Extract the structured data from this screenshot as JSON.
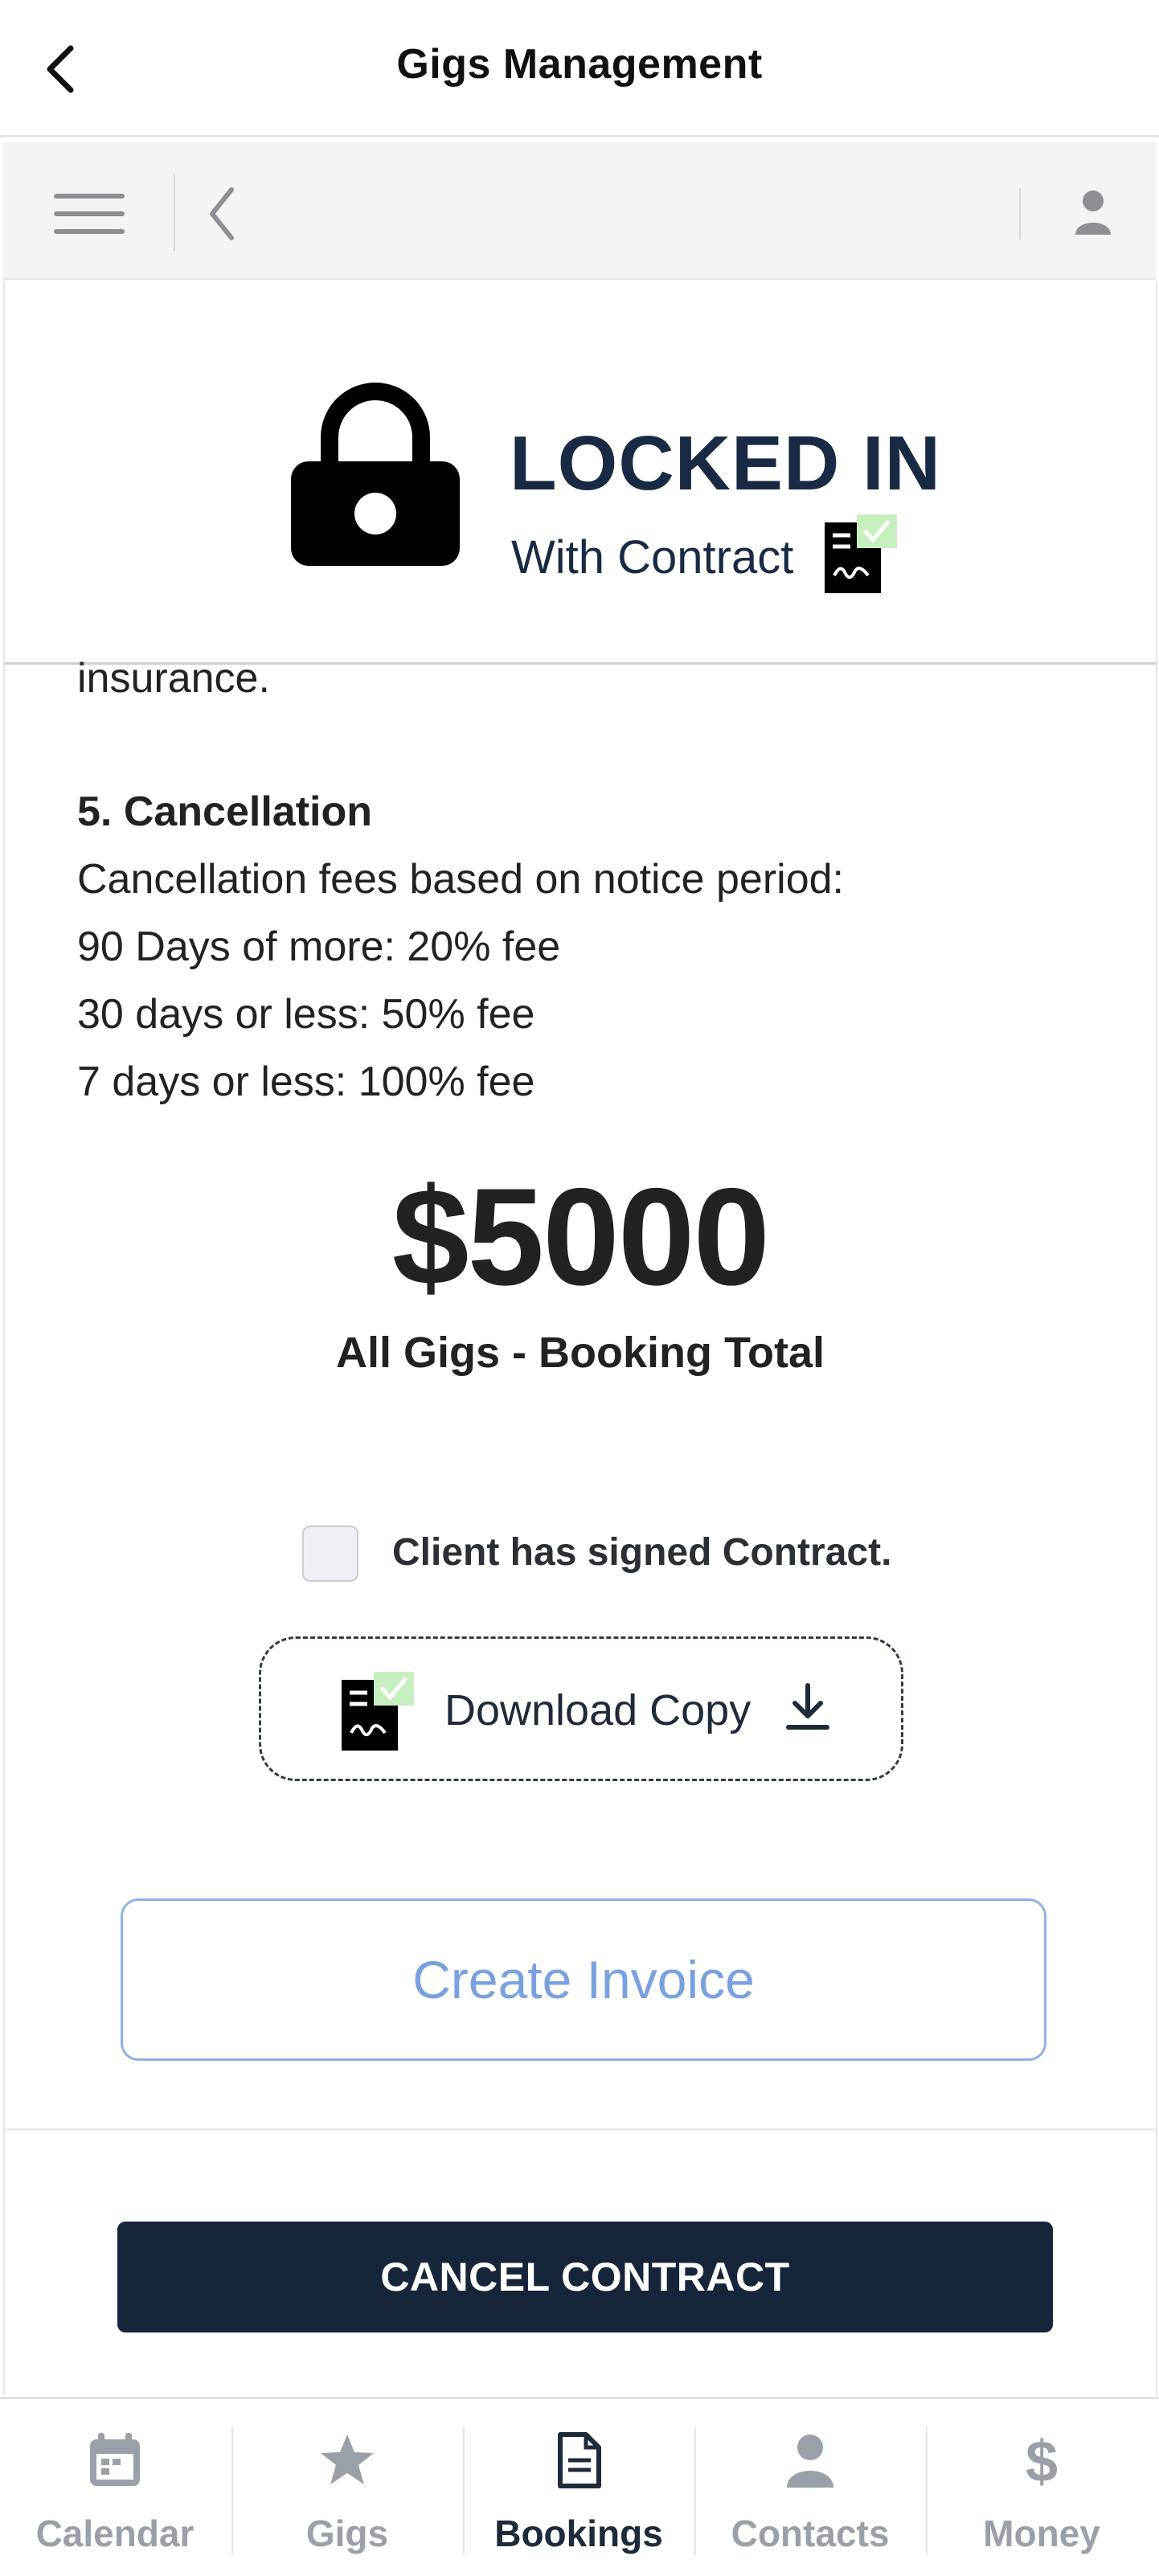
{
  "header": {
    "title": "Gigs Management"
  },
  "lock": {
    "title": "LOCKED IN",
    "subtitle": "With Contract"
  },
  "contract_text": {
    "line_partial": "insurance.",
    "section_heading": "5. Cancellation",
    "lines": [
      "Cancellation fees based on notice period:",
      "90 Days of more: 20% fee",
      "30 days or less: 50% fee",
      "7 days or less: 100% fee"
    ]
  },
  "booking": {
    "total": "$5000",
    "total_label": "All Gigs - Booking Total"
  },
  "signed_checkbox": {
    "label": "Client has signed Contract.",
    "checked": false
  },
  "download": {
    "label": "Download Copy"
  },
  "invoice": {
    "label": "Create Invoice"
  },
  "cancel": {
    "label": "CANCEL CONTRACT"
  },
  "tabs": [
    {
      "label": "Calendar",
      "icon": "calendar-icon"
    },
    {
      "label": "Gigs",
      "icon": "star-icon"
    },
    {
      "label": "Bookings",
      "icon": "document-icon",
      "active": true
    },
    {
      "label": "Contacts",
      "icon": "person-icon"
    },
    {
      "label": "Money",
      "icon": "dollar-icon"
    }
  ],
  "colors": {
    "navy": "#17253b",
    "invoice_blue": "#7aa0e0",
    "check_green": "#c8efc0"
  }
}
